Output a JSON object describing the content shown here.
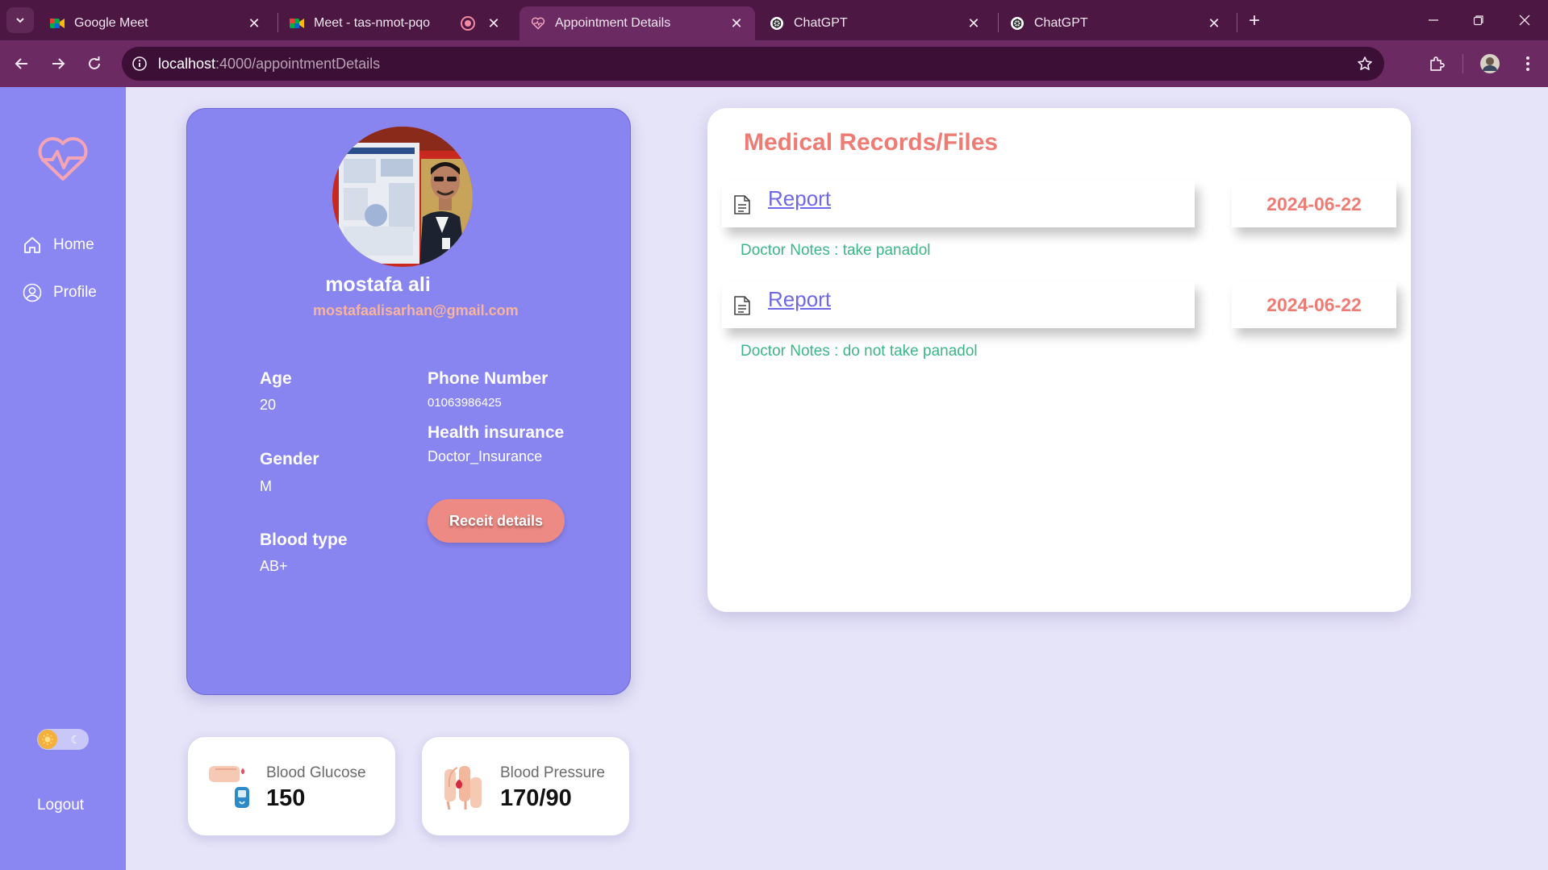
{
  "browser": {
    "tabs": [
      {
        "title": "Google Meet",
        "icon": "google-meet-icon"
      },
      {
        "title": "Meet - tas-nmot-pqo",
        "icon": "google-meet-icon",
        "recording": true
      },
      {
        "title": "Appointment Details",
        "icon": "heart-pulse-icon",
        "active": true
      },
      {
        "title": "ChatGPT",
        "icon": "chatgpt-icon"
      },
      {
        "title": "ChatGPT",
        "icon": "chatgpt-icon"
      }
    ],
    "url_host": "localhost",
    "url_path": ":4000/appointmentDetails"
  },
  "sidebar": {
    "items": [
      {
        "label": "Home",
        "icon": "home-icon"
      },
      {
        "label": "Profile",
        "icon": "user-icon"
      }
    ],
    "logout_label": "Logout",
    "theme_toggle": "light"
  },
  "profile": {
    "name": "mostafa ali",
    "email": "mostafaalisarhan@gmail.com",
    "age_label": "Age",
    "age": "20",
    "gender_label": "Gender",
    "gender": "M",
    "blood_type_label": "Blood type",
    "blood_type": "AB+",
    "phone_label": "Phone Number",
    "phone": "01063986425",
    "insurance_label": "Health insurance",
    "insurance": "Doctor_Insurance",
    "receipt_button": "Receit details"
  },
  "vitals": [
    {
      "label": "Blood Glucose",
      "value": "150",
      "icon": "glucose-meter-icon"
    },
    {
      "label": "Blood Pressure",
      "value": "170/90",
      "icon": "blood-pressure-icon"
    }
  ],
  "records": {
    "title": "Medical Records/Files",
    "items": [
      {
        "link": "Report",
        "date": "2024-06-22",
        "note": "Doctor Notes : take panadol"
      },
      {
        "link": "Report",
        "date": "2024-06-22",
        "note": "Doctor Notes : do not take panadol"
      }
    ]
  },
  "colors": {
    "sidebar": "#8b87f2",
    "profile_card": "#8884f0",
    "accent": "#ee7c74",
    "link": "#6e68e6",
    "note": "#3bb686",
    "page_bg": "#e6e4f8",
    "chrome": "#4c1743"
  }
}
